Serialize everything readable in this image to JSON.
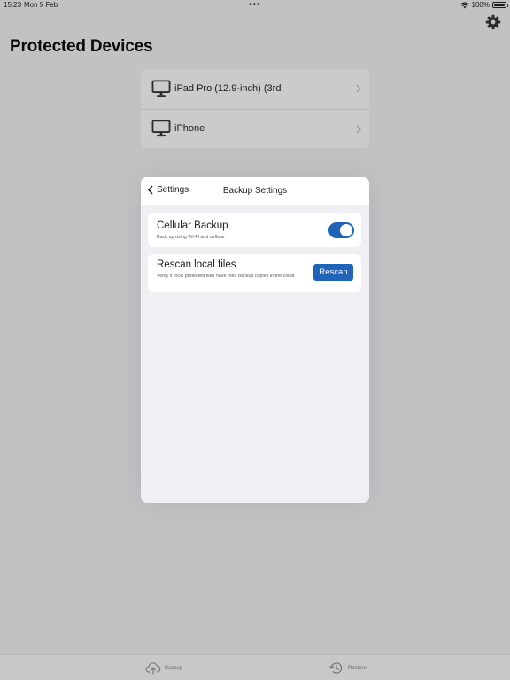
{
  "status_bar": {
    "time": "15:23",
    "date": "Mon 5 Feb",
    "dots": "•••",
    "battery": "100%"
  },
  "header": {
    "title": "Protected Devices"
  },
  "devices": [
    {
      "name": "iPad Pro (12.9-inch) (3rd"
    },
    {
      "name": "iPhone"
    }
  ],
  "modal": {
    "back_label": "Settings",
    "title": "Backup Settings",
    "cellular": {
      "title": "Cellular Backup",
      "description": "Back up using Wi-Fi and cellular",
      "enabled": true
    },
    "rescan": {
      "title": "Rescan local files",
      "description": "Verify if local protected files have their backup copies in the cloud",
      "button_label": "Rescan"
    }
  },
  "tab_bar": {
    "backup_label": "Backup",
    "restore_label": "Restore"
  },
  "icons": [
    "wifi-icon",
    "battery-icon",
    "gear-icon",
    "monitor-icon",
    "chevron-right-icon",
    "chevron-left-icon",
    "cloud-upload-icon",
    "history-icon"
  ],
  "colors": {
    "accent": "#1f64b8",
    "background": "#c2c2c4",
    "modal_background": "#efeff4"
  }
}
